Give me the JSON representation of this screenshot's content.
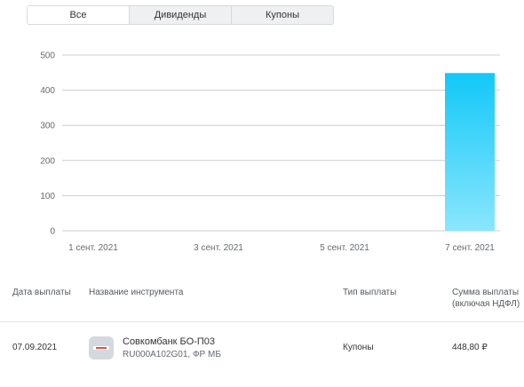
{
  "tabs": [
    {
      "label": "Все",
      "active": true
    },
    {
      "label": "Дивиденды",
      "active": false
    },
    {
      "label": "Купоны",
      "active": false
    }
  ],
  "chart_data": {
    "type": "bar",
    "categories": [
      "1 сент. 2021",
      "3 сент. 2021",
      "5 сент. 2021",
      "7 сент. 2021"
    ],
    "values": [
      0,
      0,
      0,
      448.8
    ],
    "yticks": [
      0,
      100,
      200,
      300,
      400,
      500
    ],
    "ylim": [
      0,
      500
    ],
    "grid": true,
    "bar_gradient": [
      "#12c8f8",
      "#8ae6fd"
    ]
  },
  "table": {
    "headers": {
      "date": "Дата выплаты",
      "instrument": "Название инструмента",
      "type": "Тип выплаты",
      "amount_line1": "Сумма выплаты",
      "amount_line2": "(включая НДФЛ)"
    },
    "rows": [
      {
        "date": "07.09.2021",
        "name": "Совкомбанк БО-П03",
        "sub": "RU000A102G01, ФР МБ",
        "type": "Купоны",
        "amount": "448,80 ₽"
      }
    ]
  },
  "colors": {
    "grid": "#c9cdd2",
    "text": "#333333",
    "muted": "#666a70"
  }
}
